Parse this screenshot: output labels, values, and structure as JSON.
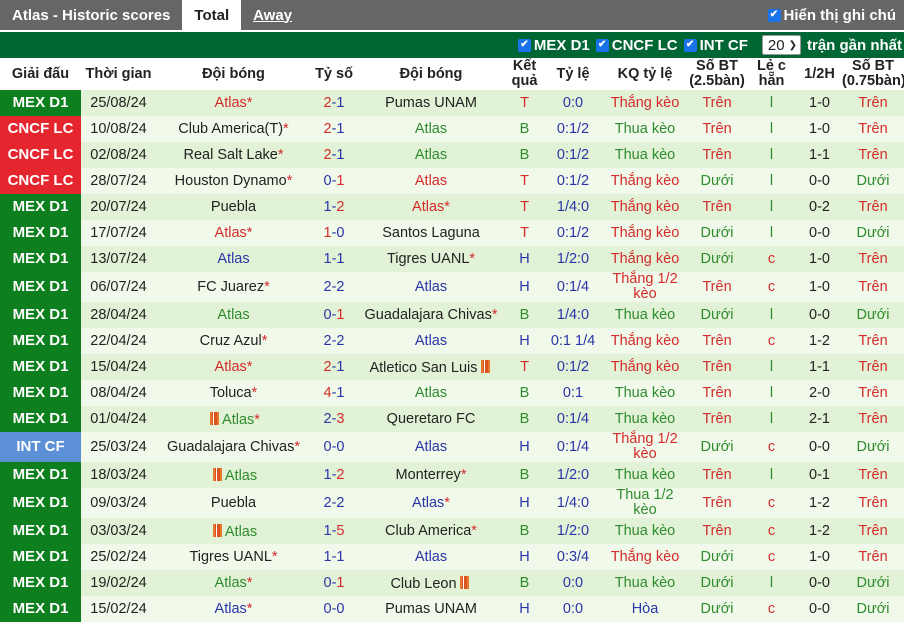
{
  "header": {
    "title": "Atlas - Historic scores",
    "tabs": [
      {
        "label": "Total",
        "active": true
      },
      {
        "label": "Away",
        "active": false
      }
    ],
    "show_notes_label": "Hiển thị ghi chú",
    "show_notes_checked": true
  },
  "filters": {
    "leagues": [
      {
        "label": "MEX D1",
        "checked": true
      },
      {
        "label": "CNCF LC",
        "checked": true
      },
      {
        "label": "INT CF",
        "checked": true
      }
    ],
    "count_value": "20",
    "count_suffix": "trận gần nhất"
  },
  "colors": {
    "MEX D1": "#0d7f1f",
    "CNCF LC": "#e5262f",
    "INT CF": "#5b8fd6",
    "red": "#d42b2b",
    "blue": "#2a35a8",
    "green": "#2e8b2e",
    "header_green": "#006633"
  },
  "columns": [
    "Giải đấu",
    "Thời gian",
    "Đội bóng",
    "Tỷ số",
    "Đội bóng",
    "Kết quả",
    "Tỷ lệ",
    "KQ tỷ lệ",
    "Số BT (2.5bàn)",
    "Lẻ c hẵn",
    "1/2H",
    "Số BT (0.75bàn)"
  ],
  "rows": [
    {
      "league": "MEX D1",
      "date": "25/08/24",
      "home": "Atlas",
      "home_star": true,
      "home_flag": false,
      "home_color": "red",
      "score_h": "2",
      "score_a": "1",
      "sh_color": "red",
      "sa_color": "blue",
      "away": "Pumas UNAM",
      "away_star": false,
      "away_flag": false,
      "away_color": "dark",
      "result": "T",
      "handicap": "0:0",
      "hres": "Thắng kèo",
      "ou": "Trên",
      "oe": "l",
      "half": "1-0",
      "ou2": "Trên"
    },
    {
      "league": "CNCF LC",
      "date": "10/08/24",
      "home": "Club America(T)",
      "home_star": true,
      "home_flag": false,
      "home_color": "dark",
      "score_h": "2",
      "score_a": "1",
      "sh_color": "red",
      "sa_color": "blue",
      "away": "Atlas",
      "away_star": false,
      "away_flag": false,
      "away_color": "green",
      "result": "B",
      "handicap": "0:1/2",
      "hres": "Thua kèo",
      "ou": "Trên",
      "oe": "l",
      "half": "1-0",
      "ou2": "Trên"
    },
    {
      "league": "CNCF LC",
      "date": "02/08/24",
      "home": "Real Salt Lake",
      "home_star": true,
      "home_flag": false,
      "home_color": "dark",
      "score_h": "2",
      "score_a": "1",
      "sh_color": "red",
      "sa_color": "blue",
      "away": "Atlas",
      "away_star": false,
      "away_flag": false,
      "away_color": "green",
      "result": "B",
      "handicap": "0:1/2",
      "hres": "Thua kèo",
      "ou": "Trên",
      "oe": "l",
      "half": "1-1",
      "ou2": "Trên"
    },
    {
      "league": "CNCF LC",
      "date": "28/07/24",
      "home": "Houston Dynamo",
      "home_star": true,
      "home_flag": false,
      "home_color": "dark",
      "score_h": "0",
      "score_a": "1",
      "sh_color": "blue",
      "sa_color": "red",
      "away": "Atlas",
      "away_star": false,
      "away_flag": false,
      "away_color": "red",
      "result": "T",
      "handicap": "0:1/2",
      "hres": "Thắng kèo",
      "ou": "Dưới",
      "oe": "l",
      "half": "0-0",
      "ou2": "Dưới"
    },
    {
      "league": "MEX D1",
      "date": "20/07/24",
      "home": "Puebla",
      "home_star": false,
      "home_flag": false,
      "home_color": "dark",
      "score_h": "1",
      "score_a": "2",
      "sh_color": "blue",
      "sa_color": "red",
      "away": "Atlas",
      "away_star": true,
      "away_flag": false,
      "away_color": "red",
      "result": "T",
      "handicap": "1/4:0",
      "hres": "Thắng kèo",
      "ou": "Trên",
      "oe": "l",
      "half": "0-2",
      "ou2": "Trên"
    },
    {
      "league": "MEX D1",
      "date": "17/07/24",
      "home": "Atlas",
      "home_star": true,
      "home_flag": false,
      "home_color": "red",
      "score_h": "1",
      "score_a": "0",
      "sh_color": "red",
      "sa_color": "blue",
      "away": "Santos Laguna",
      "away_star": false,
      "away_flag": false,
      "away_color": "dark",
      "result": "T",
      "handicap": "0:1/2",
      "hres": "Thắng kèo",
      "ou": "Dưới",
      "oe": "l",
      "half": "0-0",
      "ou2": "Dưới"
    },
    {
      "league": "MEX D1",
      "date": "13/07/24",
      "home": "Atlas",
      "home_star": false,
      "home_flag": false,
      "home_color": "blue",
      "score_h": "1",
      "score_a": "1",
      "sh_color": "blue",
      "sa_color": "blue",
      "away": "Tigres UANL",
      "away_star": true,
      "away_flag": false,
      "away_color": "dark",
      "result": "H",
      "handicap": "1/2:0",
      "hres": "Thắng kèo",
      "ou": "Dưới",
      "oe": "c",
      "half": "1-0",
      "ou2": "Trên"
    },
    {
      "league": "MEX D1",
      "date": "06/07/24",
      "home": "FC Juarez",
      "home_star": true,
      "home_flag": false,
      "home_color": "dark",
      "score_h": "2",
      "score_a": "2",
      "sh_color": "blue",
      "sa_color": "blue",
      "away": "Atlas",
      "away_star": false,
      "away_flag": false,
      "away_color": "blue",
      "result": "H",
      "handicap": "0:1/4",
      "hres": "Thắng 1/2 kèo",
      "ou": "Trên",
      "oe": "c",
      "half": "1-0",
      "ou2": "Trên",
      "tall": true
    },
    {
      "league": "MEX D1",
      "date": "28/04/24",
      "home": "Atlas",
      "home_star": false,
      "home_flag": false,
      "home_color": "green",
      "score_h": "0",
      "score_a": "1",
      "sh_color": "blue",
      "sa_color": "red",
      "away": "Guadalajara Chivas",
      "away_star": true,
      "away_flag": false,
      "away_color": "dark",
      "result": "B",
      "handicap": "1/4:0",
      "hres": "Thua kèo",
      "ou": "Dưới",
      "oe": "l",
      "half": "0-0",
      "ou2": "Dưới"
    },
    {
      "league": "MEX D1",
      "date": "22/04/24",
      "home": "Cruz Azul",
      "home_star": true,
      "home_flag": false,
      "home_color": "dark",
      "score_h": "2",
      "score_a": "2",
      "sh_color": "blue",
      "sa_color": "blue",
      "away": "Atlas",
      "away_star": false,
      "away_flag": false,
      "away_color": "blue",
      "result": "H",
      "handicap": "0:1 1/4",
      "hres": "Thắng kèo",
      "ou": "Trên",
      "oe": "c",
      "half": "1-2",
      "ou2": "Trên"
    },
    {
      "league": "MEX D1",
      "date": "15/04/24",
      "home": "Atlas",
      "home_star": true,
      "home_flag": false,
      "home_color": "red",
      "score_h": "2",
      "score_a": "1",
      "sh_color": "red",
      "sa_color": "blue",
      "away": "Atletico San Luis",
      "away_star": false,
      "away_flag": true,
      "away_color": "dark",
      "result": "T",
      "handicap": "0:1/2",
      "hres": "Thắng kèo",
      "ou": "Trên",
      "oe": "l",
      "half": "1-1",
      "ou2": "Trên"
    },
    {
      "league": "MEX D1",
      "date": "08/04/24",
      "home": "Toluca",
      "home_star": true,
      "home_flag": false,
      "home_color": "dark",
      "score_h": "4",
      "score_a": "1",
      "sh_color": "red",
      "sa_color": "blue",
      "away": "Atlas",
      "away_star": false,
      "away_flag": false,
      "away_color": "green",
      "result": "B",
      "handicap": "0:1",
      "hres": "Thua kèo",
      "ou": "Trên",
      "oe": "l",
      "half": "2-0",
      "ou2": "Trên"
    },
    {
      "league": "MEX D1",
      "date": "01/04/24",
      "home": "Atlas",
      "home_star": true,
      "home_flag": true,
      "home_color": "green",
      "score_h": "2",
      "score_a": "3",
      "sh_color": "blue",
      "sa_color": "red",
      "away": "Queretaro FC",
      "away_star": false,
      "away_flag": false,
      "away_color": "dark",
      "result": "B",
      "handicap": "0:1/4",
      "hres": "Thua kèo",
      "ou": "Trên",
      "oe": "l",
      "half": "2-1",
      "ou2": "Trên"
    },
    {
      "league": "INT CF",
      "date": "25/03/24",
      "home": "Guadalajara Chivas",
      "home_star": true,
      "home_flag": false,
      "home_color": "dark",
      "score_h": "0",
      "score_a": "0",
      "sh_color": "blue",
      "sa_color": "blue",
      "away": "Atlas",
      "away_star": false,
      "away_flag": false,
      "away_color": "blue",
      "result": "H",
      "handicap": "0:1/4",
      "hres": "Thắng 1/2 kèo",
      "ou": "Dưới",
      "oe": "c",
      "half": "0-0",
      "ou2": "Dưới",
      "tall": true
    },
    {
      "league": "MEX D1",
      "date": "18/03/24",
      "home": "Atlas",
      "home_star": false,
      "home_flag": true,
      "home_color": "green",
      "score_h": "1",
      "score_a": "2",
      "sh_color": "blue",
      "sa_color": "red",
      "away": "Monterrey",
      "away_star": true,
      "away_flag": false,
      "away_color": "dark",
      "result": "B",
      "handicap": "1/2:0",
      "hres": "Thua kèo",
      "ou": "Trên",
      "oe": "l",
      "half": "0-1",
      "ou2": "Trên"
    },
    {
      "league": "MEX D1",
      "date": "09/03/24",
      "home": "Puebla",
      "home_star": false,
      "home_flag": false,
      "home_color": "dark",
      "score_h": "2",
      "score_a": "2",
      "sh_color": "blue",
      "sa_color": "blue",
      "away": "Atlas",
      "away_star": true,
      "away_flag": false,
      "away_color": "blue",
      "result": "H",
      "handicap": "1/4:0",
      "hres": "Thua 1/2 kèo",
      "ou": "Trên",
      "oe": "c",
      "half": "1-2",
      "ou2": "Trên",
      "tall": true
    },
    {
      "league": "MEX D1",
      "date": "03/03/24",
      "home": "Atlas",
      "home_star": false,
      "home_flag": true,
      "home_color": "green",
      "score_h": "1",
      "score_a": "5",
      "sh_color": "blue",
      "sa_color": "red",
      "away": "Club America",
      "away_star": true,
      "away_flag": false,
      "away_color": "dark",
      "result": "B",
      "handicap": "1/2:0",
      "hres": "Thua kèo",
      "ou": "Trên",
      "oe": "c",
      "half": "1-2",
      "ou2": "Trên"
    },
    {
      "league": "MEX D1",
      "date": "25/02/24",
      "home": "Tigres UANL",
      "home_star": true,
      "home_flag": false,
      "home_color": "dark",
      "score_h": "1",
      "score_a": "1",
      "sh_color": "blue",
      "sa_color": "blue",
      "away": "Atlas",
      "away_star": false,
      "away_flag": false,
      "away_color": "blue",
      "result": "H",
      "handicap": "0:3/4",
      "hres": "Thắng kèo",
      "ou": "Dưới",
      "oe": "c",
      "half": "1-0",
      "ou2": "Trên"
    },
    {
      "league": "MEX D1",
      "date": "19/02/24",
      "home": "Atlas",
      "home_star": true,
      "home_flag": false,
      "home_color": "green",
      "score_h": "0",
      "score_a": "1",
      "sh_color": "blue",
      "sa_color": "red",
      "away": "Club Leon",
      "away_star": false,
      "away_flag": true,
      "away_color": "dark",
      "result": "B",
      "handicap": "0:0",
      "hres": "Thua kèo",
      "ou": "Dưới",
      "oe": "l",
      "half": "0-0",
      "ou2": "Dưới"
    },
    {
      "league": "MEX D1",
      "date": "15/02/24",
      "home": "Atlas",
      "home_star": true,
      "home_flag": false,
      "home_color": "blue",
      "score_h": "0",
      "score_a": "0",
      "sh_color": "blue",
      "sa_color": "blue",
      "away": "Pumas UNAM",
      "away_star": false,
      "away_flag": false,
      "away_color": "dark",
      "result": "H",
      "handicap": "0:0",
      "hres": "Hòa",
      "ou": "Dưới",
      "oe": "c",
      "half": "0-0",
      "ou2": "Dưới"
    }
  ]
}
